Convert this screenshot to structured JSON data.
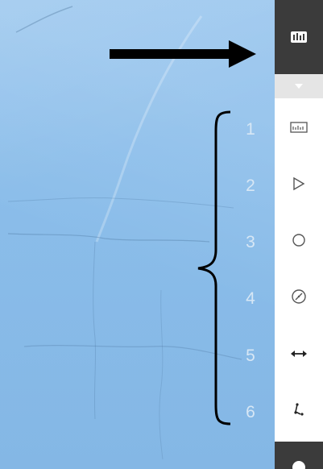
{
  "annotations": {
    "numbers": [
      "1",
      "2",
      "3",
      "4",
      "5",
      "6"
    ]
  },
  "toolbar": {
    "tools": [
      {
        "icon": "measure-profile-icon"
      },
      {
        "icon": "triangle-play-icon"
      },
      {
        "icon": "circle-icon"
      },
      {
        "icon": "compass-icon"
      },
      {
        "icon": "horizontal-distance-icon"
      },
      {
        "icon": "path-line-icon"
      }
    ]
  }
}
